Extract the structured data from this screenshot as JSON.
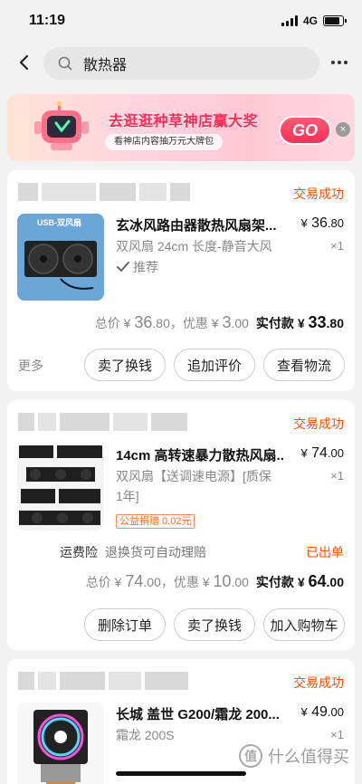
{
  "status_bar": {
    "time": "11:19",
    "network": "4G",
    "battery_level": 0.85
  },
  "search": {
    "query": "散热器",
    "back_icon": "chevron-left-icon",
    "search_icon": "search-icon",
    "more_icon": "more-dots-icon"
  },
  "banner": {
    "title": "去逛逛种草神店赢大奖",
    "subtitle": "看神店内容抽万元大牌包",
    "go_label": "GO",
    "close_symbol": "×"
  },
  "orders": [
    {
      "status": "交易成功",
      "thumb_caption": "USB-双风扇",
      "title": "玄冰风路由器散热风扇架...",
      "price_symbol": "¥",
      "price_int": "36",
      "price_dec": ".80",
      "qty": "×1",
      "spec": "双风扇 24cm 长度-静音大风",
      "recommend": "推荐",
      "total_label": "总价",
      "total_int": "36",
      "total_dec": ".80",
      "discount_label": "，优惠",
      "discount_int": "3",
      "discount_dec": ".00",
      "paid_label": "实付款",
      "paid_int": "33",
      "paid_dec": ".80",
      "more_label": "更多",
      "buttons": [
        "卖了换钱",
        "追加评价",
        "查看物流"
      ]
    },
    {
      "status": "交易成功",
      "title": "14cm 高转速暴力散热风扇...",
      "price_symbol": "¥",
      "price_int": "74",
      "price_dec": ".00",
      "qty": "×1",
      "spec_line1": "双风扇【送调速电源】[质保",
      "spec_line2": "1年]",
      "charity": "公益捐赠 0.02元",
      "service_label": "运费险",
      "service_sub": "退换货可自动理赔",
      "ship_status": "已出单",
      "total_label": "总价",
      "total_int": "74",
      "total_dec": ".00",
      "discount_label": "，优惠",
      "discount_int": "10",
      "discount_dec": ".00",
      "paid_label": "实付款",
      "paid_int": "64",
      "paid_dec": ".00",
      "buttons": [
        "删除订单",
        "卖了换钱",
        "加入购物车"
      ]
    },
    {
      "status": "交易成功",
      "title": "长城 盖世 G200/霜龙 200...",
      "price_symbol": "¥",
      "price_int": "49",
      "price_dec": ".00",
      "qty": "×1",
      "spec": "霜龙 200S"
    }
  ],
  "watermark": {
    "text": "什么值得买",
    "logo": "值"
  }
}
